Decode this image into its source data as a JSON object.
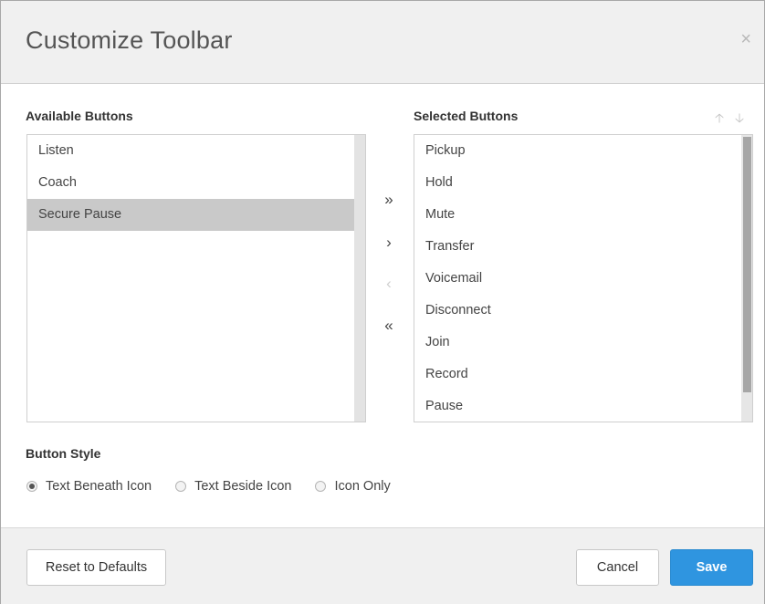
{
  "dialog": {
    "title": "Customize Toolbar",
    "close_glyph": "×"
  },
  "available": {
    "label": "Available Buttons",
    "items": [
      "Listen",
      "Coach",
      "Secure Pause"
    ],
    "selected_index": 2
  },
  "selected": {
    "label": "Selected Buttons",
    "items": [
      "Pickup",
      "Hold",
      "Mute",
      "Transfer",
      "Voicemail",
      "Disconnect",
      "Join",
      "Record",
      "Pause"
    ],
    "move_up_glyph": "🡡",
    "move_down_glyph": "🡣"
  },
  "transfer": {
    "add_all": "»",
    "add": "›",
    "remove": "‹",
    "remove_all": "«"
  },
  "button_style": {
    "label": "Button Style",
    "options": [
      "Text Beneath Icon",
      "Text Beside Icon",
      "Icon Only"
    ],
    "checked": "Text Beneath Icon"
  },
  "footer": {
    "reset_label": "Reset to Defaults",
    "cancel_label": "Cancel",
    "save_label": "Save"
  },
  "colors": {
    "primary": "#2f95e0",
    "header_bg": "#f0f0f0",
    "selection_bg": "#c9c9c9"
  },
  "icons": {
    "close": "close-icon",
    "add_all": "double-chevron-right-icon",
    "add": "chevron-right-icon",
    "remove": "chevron-left-icon",
    "remove_all": "double-chevron-left-icon",
    "move_up": "arrow-up-icon",
    "move_down": "arrow-down-icon"
  }
}
